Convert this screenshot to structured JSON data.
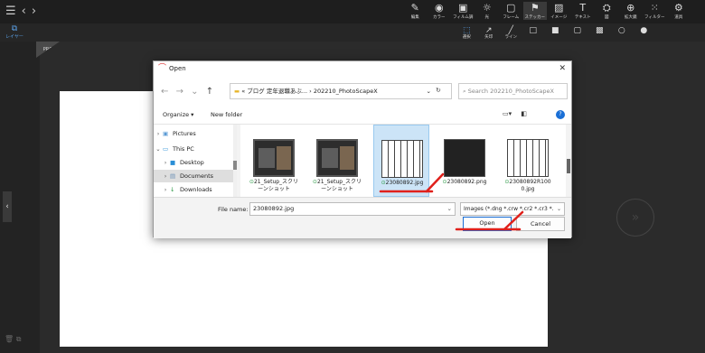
{
  "toolbar": {
    "tools": [
      {
        "icon": "✎",
        "label": "編集"
      },
      {
        "icon": "◉",
        "label": "カラー"
      },
      {
        "icon": "▣",
        "label": "フィルム調"
      },
      {
        "icon": "☼",
        "label": "光"
      },
      {
        "icon": "▢",
        "label": "フレーム"
      },
      {
        "icon": "⚑",
        "label": "ステッカー"
      },
      {
        "icon": "▨",
        "label": "イメージ"
      },
      {
        "icon": "T",
        "label": "テキスト"
      },
      {
        "icon": "⛭",
        "label": "図"
      },
      {
        "icon": "⊕",
        "label": "拡大鏡"
      },
      {
        "icon": "⁙",
        "label": "フィルター"
      },
      {
        "icon": "⚙",
        "label": "道具"
      }
    ]
  },
  "subbar": {
    "layer_label": "レイヤー",
    "select_label": "選択",
    "arrow_label": "矢印",
    "line_label": "ライン"
  },
  "canvas": {
    "badge": "PRO"
  },
  "dialog": {
    "title": "Open",
    "address": [
      "ブログ",
      "定年退職あぶ...",
      "202210_PhotoScapeX"
    ],
    "search_placeholder": "Search 202210_PhotoScapeX",
    "organize_label": "Organize ▾",
    "new_folder_label": "New folder",
    "nav": [
      "Pictures",
      "This PC",
      "Desktop",
      "Documents",
      "Downloads"
    ],
    "files": [
      {
        "line1": "21_Setup_スクリ",
        "line2": "ーンショット"
      },
      {
        "line1": "21_Setup_スクリ",
        "line2": "ーンショット"
      },
      {
        "line1": "23080892.jpg",
        "line2": ""
      },
      {
        "line1": "23080892.png",
        "line2": ""
      },
      {
        "line1": "23080892R100",
        "line2": "0.jpg"
      }
    ],
    "filename_label": "File name:",
    "filename_value": "23080892.jpg",
    "filetype_value": "Images (*.dng *.crw *.cr2 *.cr3 *.",
    "open_label": "Open",
    "cancel_label": "Cancel"
  },
  "colors": {
    "accent": "#1a6fd6",
    "annotation": "#e0201b",
    "selection": "#cce4f7"
  }
}
